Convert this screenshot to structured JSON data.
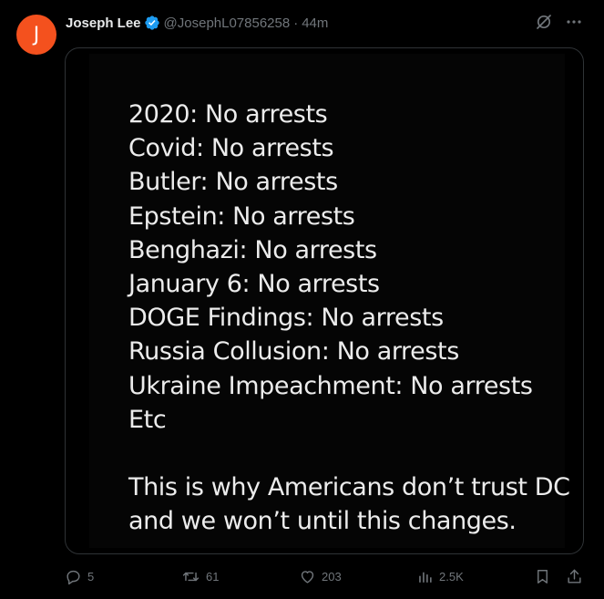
{
  "author": {
    "avatar_letter": "J",
    "avatar_color": "#f4511e",
    "display_name": "Joseph Lee",
    "verified_icon": "verified-badge-icon",
    "handle": "@JosephL07856258",
    "separator": "·",
    "time": "44m"
  },
  "header_icons": [
    "grok-icon",
    "more-options-icon"
  ],
  "media": {
    "lines": [
      "2020: No arrests",
      "Covid: No arrests",
      "Butler: No arrests",
      "Epstein: No arrests",
      "Benghazi: No arrests",
      "January 6: No arrests",
      "DOGE Findings: No arrests",
      "Russia Collusion: No arrests",
      "Ukraine Impeachment: No arrests",
      "Etc"
    ],
    "closing": [
      "This is why Americans don’t trust DC",
      "and we won’t until this changes."
    ]
  },
  "actions": {
    "replies": "5",
    "reposts": "61",
    "likes": "203",
    "views": "2.5K"
  },
  "colors": {
    "background": "#000000",
    "text": "#e7e9ea",
    "muted": "#71767b",
    "verified": "#1d9bf0",
    "border": "#2f3336"
  }
}
